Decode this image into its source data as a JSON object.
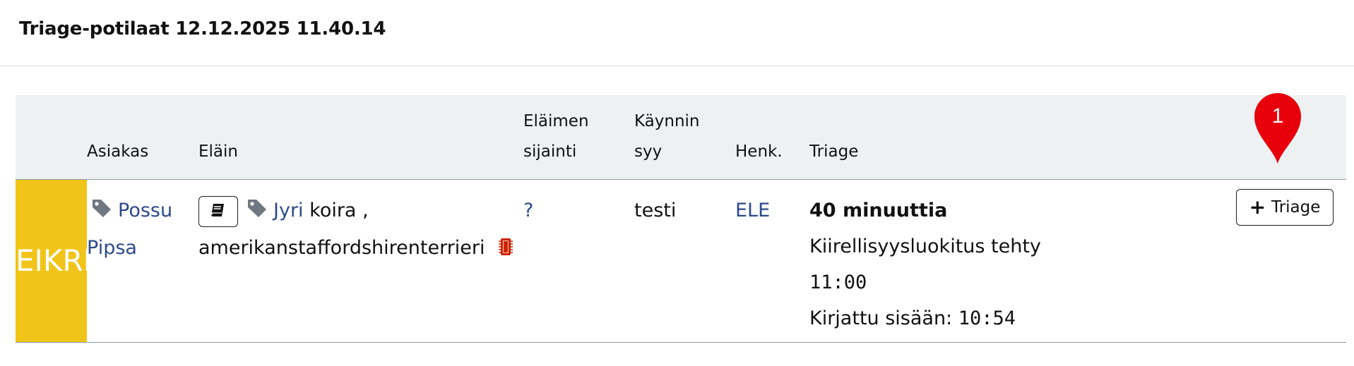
{
  "header": {
    "title": "Triage-potilaat 12.12.2025 11.40.14"
  },
  "table": {
    "columns": {
      "asiakas": "Asiakas",
      "elain": "Eläin",
      "sijainti_1": "Eläimen",
      "sijainti_2": "sijainti",
      "syy_1": "Käynnin",
      "syy_2": "syy",
      "henk": "Henk.",
      "triage": "Triage"
    },
    "rows": [
      {
        "priority": "EIKRI",
        "priority_color": "#f0c419",
        "customer_first": "Possu",
        "customer_last": "Pipsa",
        "animal_name": "Jyri",
        "animal_species": "koira ,",
        "animal_breed": "amerikanstaffordshirenterrieri",
        "location": "?",
        "reason": "testi",
        "staff": "ELE",
        "wait": "40 minuuttia",
        "triage_done_label": "Kiirellisyysluokitus tehty",
        "triage_done_time": "11:00",
        "checkin_label": "Kirjattu sisään:",
        "checkin_time": "10:54",
        "button_label": "Triage"
      }
    ]
  },
  "marker": {
    "number": "1",
    "color": "#e8000b"
  },
  "icons": {
    "tag": "tag-icon",
    "record": "book-icon",
    "chip": "microchip-icon",
    "plus": "plus-icon"
  },
  "colors": {
    "link": "#2d4a8a",
    "header_bg": "#eef1f2",
    "chip": "#cc2200"
  }
}
